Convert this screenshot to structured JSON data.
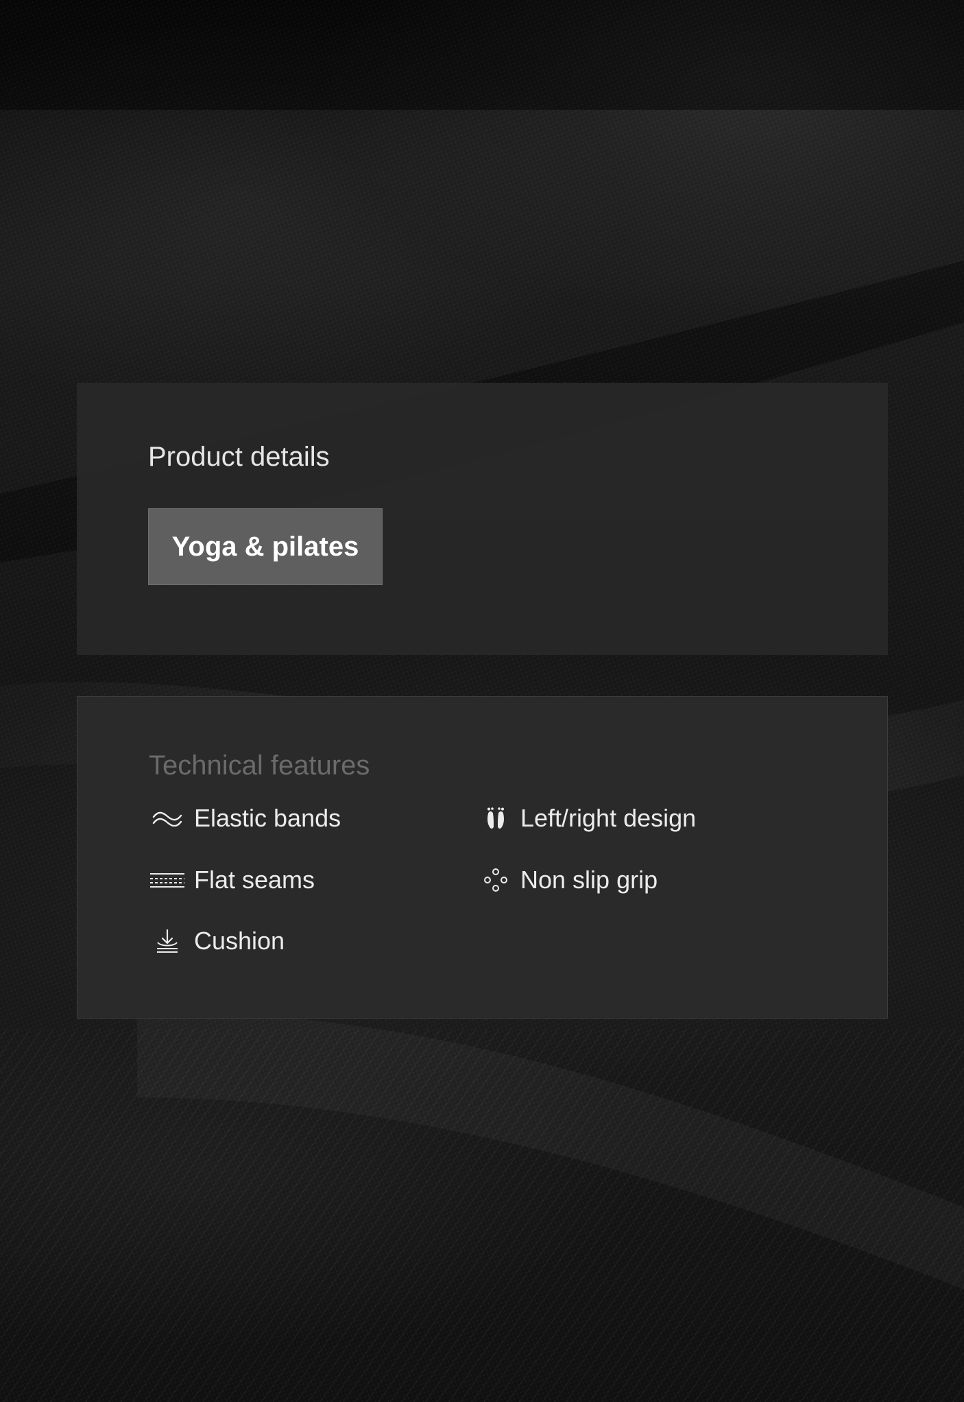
{
  "product_details": {
    "title": "Product details",
    "tag_label": "Yoga & pilates"
  },
  "technical_features": {
    "title": "Technical features",
    "items": [
      {
        "label": "Elastic bands",
        "icon": "waves-icon"
      },
      {
        "label": "Flat seams",
        "icon": "seam-lines-icon"
      },
      {
        "label": "Cushion",
        "icon": "cushion-icon"
      },
      {
        "label": "Left/right design",
        "icon": "feet-icon"
      },
      {
        "label": "Non slip grip",
        "icon": "grip-dots-icon"
      }
    ]
  },
  "colors": {
    "panel_background": "#2a2a2a",
    "tag_background": "#5f5f5f",
    "text_primary": "#ececec",
    "text_muted": "#6b6b6b"
  }
}
